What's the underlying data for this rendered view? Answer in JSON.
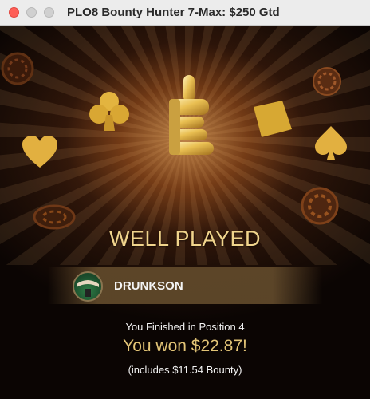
{
  "window": {
    "title": "PLO8 Bounty Hunter 7-Max: $250 Gtd"
  },
  "result": {
    "headline": "WELL PLAYED",
    "player_name": "DRUNKSON",
    "finish_text": "You Finished in Position 4",
    "won_text": "You won $22.87!",
    "bounty_text": "(includes $11.54 Bounty)"
  },
  "icons": {
    "logo": "thumbs-up-e-logo-icon",
    "suits": [
      "club-icon",
      "heart-icon",
      "diamond-icon",
      "spade-icon"
    ],
    "chips": [
      "poker-chip-icon"
    ]
  },
  "colors": {
    "headline": "#f1d48c",
    "won": "#e2c476",
    "close": "#fe5f57"
  }
}
